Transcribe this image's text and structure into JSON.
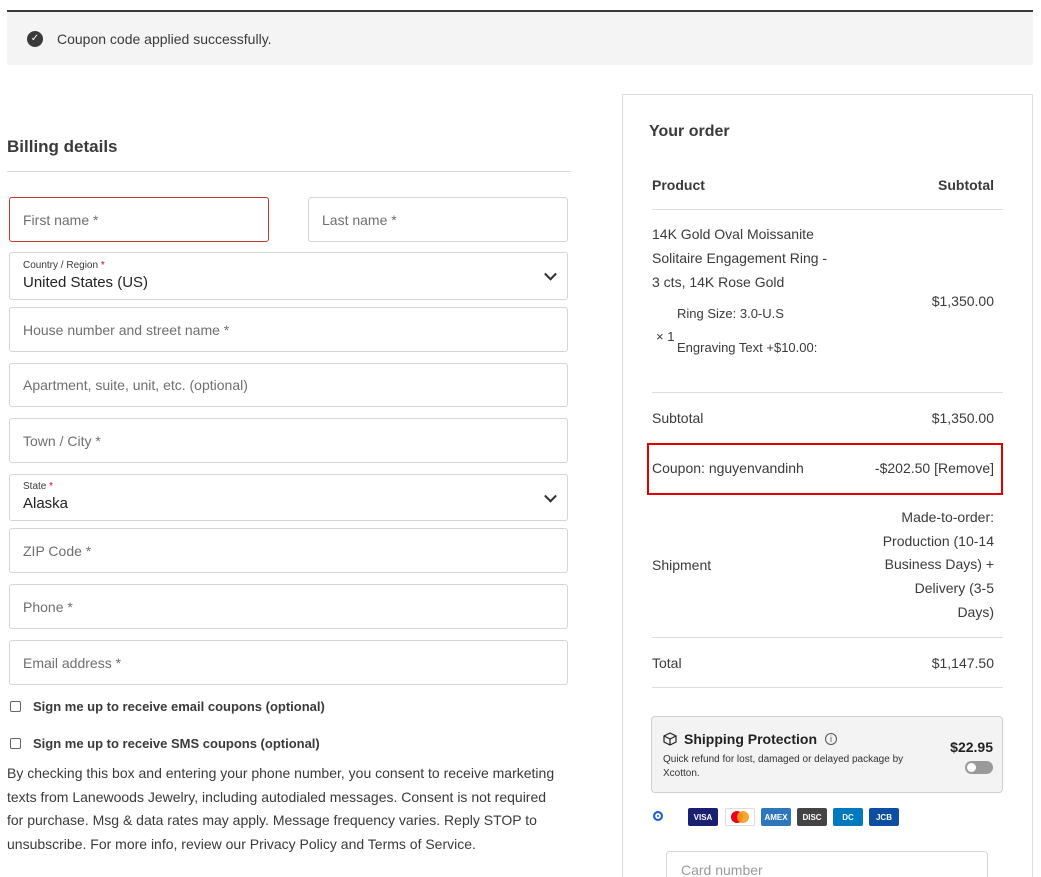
{
  "notice": {
    "message": "Coupon code applied successfully."
  },
  "billing": {
    "title": "Billing details",
    "first_name": "First name *",
    "last_name": "Last name *",
    "country_label": "Country / Region",
    "country_value": "United States (US)",
    "street": "House number and street name *",
    "apartment": "Apartment, suite, unit, etc. (optional)",
    "city": "Town / City *",
    "state_label": "State",
    "state_value": "Alaska",
    "zip": "ZIP Code *",
    "phone": "Phone *",
    "email": "Email address *",
    "email_coupons": "Sign me up to receive email coupons (optional)",
    "sms_coupons": "Sign me up to receive SMS coupons (optional)",
    "consent": "By checking this box and entering your phone number, you consent to receive marketing texts from Lanewoods Jewelry, including autodialed messages. Consent is not required for purchase. Msg & data rates may apply. Message frequency varies. Reply STOP to unsubscribe. For more info, review our Privacy Policy and Terms of Service."
  },
  "order": {
    "title": "Your order",
    "col_product": "Product",
    "col_subtotal": "Subtotal",
    "item_name_1": "14K Gold Oval Moissanite",
    "item_name_2": "Solitaire Engagement Ring -",
    "item_name_3": "3 cts, 14K Rose Gold",
    "ring_size": "Ring Size: 3.0-U.S",
    "qty": "× 1",
    "engraving": "Engraving Text +$10.00:",
    "item_price": "$1,350.00",
    "subtotal_label": "Subtotal",
    "subtotal_value": "$1,350.00",
    "coupon_label": "Coupon: nguyenvandinh",
    "coupon_value": "-$202.50 [Remove]",
    "shipment_label": "Shipment",
    "shipment_1": "Made-to-order:",
    "shipment_2": "Production (10-14",
    "shipment_3": "Business Days) +",
    "shipment_4": "Delivery (3-5",
    "shipment_5": "Days)",
    "total_label": "Total",
    "total_value": "$1,147.50"
  },
  "protection": {
    "title": "Shipping Protection",
    "desc": "Quick refund for lost, damaged or delayed package by Xcotton.",
    "price": "$22.95"
  },
  "payment": {
    "cards": [
      "VISA",
      "MC",
      "AMEX",
      "DISC",
      "DC",
      "JCB"
    ],
    "card_number": "Card number"
  }
}
